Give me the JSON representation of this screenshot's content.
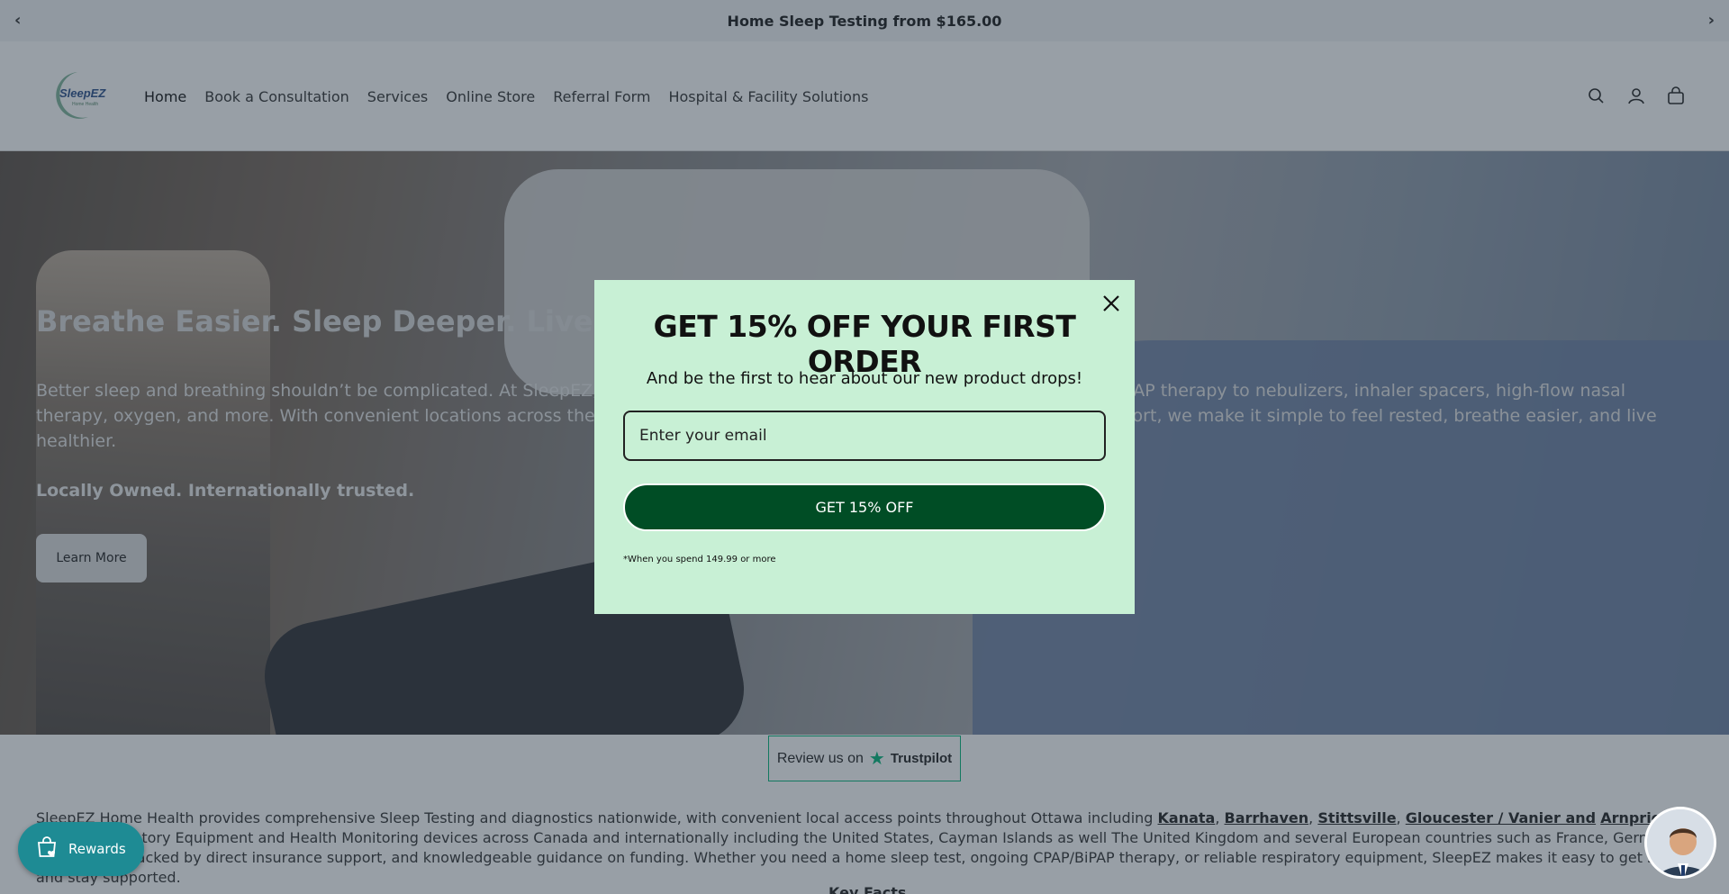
{
  "announcement": {
    "text": "Home Sleep Testing from $165.00",
    "prev_icon": "chevron-left-icon",
    "next_icon": "chevron-right-icon"
  },
  "header": {
    "logo_text": "SleepEZ",
    "logo_subtext": "Home Health",
    "nav": [
      {
        "label": "Home"
      },
      {
        "label": "Book a Consultation"
      },
      {
        "label": "Services"
      },
      {
        "label": "Online Store"
      },
      {
        "label": "Referral Form"
      },
      {
        "label": "Hospital & Facility Solutions"
      }
    ],
    "icons": [
      "search-icon",
      "account-icon",
      "cart-icon"
    ]
  },
  "hero": {
    "title": "Breathe Easier. Sleep Deeper. Live Better.",
    "text": "Better sleep and breathing shouldn’t be complicated. At SleepEZ, we provide everything from Home Sleep Testing and CPAP/BiPAP therapy to nebulizers, inhaler spacers, high-flow nasal therapy, oxygen, and more. With convenient locations across the Ottawa region, easy product guidance, and personalized support, we make it simple to feel rested, breathe easier, and live healthier.",
    "tagline": "Locally Owned. Internationally trusted.",
    "button_label": "Learn More"
  },
  "trustpilot": {
    "prefix": "Review us on",
    "brand": "Trustpilot"
  },
  "lower": {
    "text_before": "SleepEZ Home Health provides comprehensive Sleep Testing and diagnostics nationwide, with convenient local access points throughout Ottawa including ",
    "locations": [
      "Kanata",
      "Barrhaven",
      "Stittsville",
      "Gloucester / Vanier and",
      "Arnprior"
    ],
    "text_after": ". We supply Respiratory Equipment and Health Monitoring devices across Canada and internationally including the United States, Cayman Islands as well The United Kingdom and several European countries such as France, Germany and Ireland. Backed by direct insurance support, and knowledgeable guidance on funding. Whether you need a home sleep test, ongoing CPAP/BiPAP therapy, or reliable respiratory equipment, SleepEZ makes it easy to get started and stay supported.",
    "key_facts": "Key Facts"
  },
  "modal": {
    "title": "GET 15% OFF YOUR FIRST ORDER",
    "subtitle": "And be the first to hear about our new product drops!",
    "email_placeholder": "Enter your email",
    "button_label": "GET 15% OFF",
    "note": "*When you spend 149.99 or more",
    "close_icon": "close-icon"
  },
  "rewards": {
    "label": "Rewards",
    "icon": "shopping-bag-heart-icon"
  },
  "chat": {
    "icon": "chat-avatar-icon"
  },
  "colors": {
    "modal_bg": "#c8f0d5",
    "modal_button": "#004d25",
    "rewards": "#1e8b94",
    "trustpilot_green": "#00b67a"
  }
}
